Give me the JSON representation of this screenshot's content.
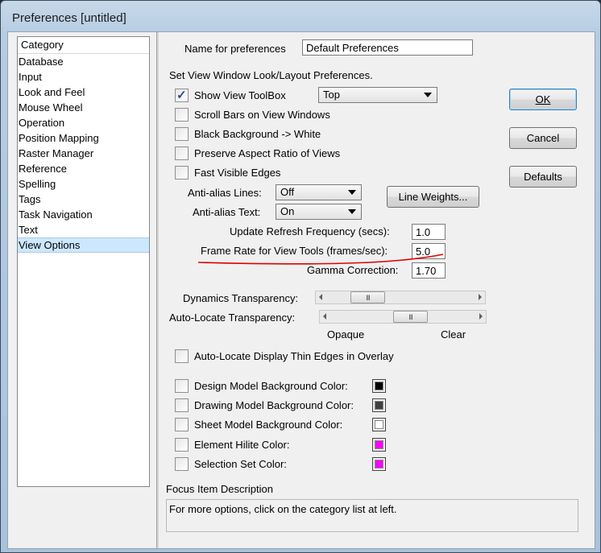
{
  "window": {
    "title": "Preferences [untitled]"
  },
  "category": {
    "header": "Category",
    "items": [
      "Database",
      "Input",
      "Look and Feel",
      "Mouse Wheel",
      "Operation",
      "Position Mapping",
      "Raster Manager",
      "Reference",
      "Spelling",
      "Tags",
      "Task Navigation",
      "Text",
      "View Options"
    ],
    "selected": "View Options"
  },
  "name_field": {
    "label": "Name for preferences",
    "value": "Default Preferences"
  },
  "section_title": "Set View Window Look/Layout Preferences.",
  "checkboxes": [
    {
      "label": "Show View ToolBox",
      "checked": true
    },
    {
      "label": "Scroll Bars on View Windows",
      "checked": false
    },
    {
      "label": "Black Background -> White",
      "checked": false
    },
    {
      "label": "Preserve Aspect Ratio of Views",
      "checked": false
    },
    {
      "label": "Fast Visible Edges",
      "checked": false
    }
  ],
  "toolbox_position": {
    "value": "Top"
  },
  "antialias_lines": {
    "label": "Anti-alias Lines:",
    "value": "Off"
  },
  "antialias_text": {
    "label": "Anti-alias Text:",
    "value": "On"
  },
  "line_weights_button": "Line Weights...",
  "update_refresh": {
    "label": "Update Refresh Frequency (secs):",
    "value": "1.0"
  },
  "frame_rate": {
    "label": "Frame Rate for View Tools (frames/sec):",
    "value": "5.0"
  },
  "gamma": {
    "label": "Gamma Correction:",
    "value": "1.70"
  },
  "dynamics_transparency": {
    "label": "Dynamics Transparency:",
    "level": 0.22
  },
  "autolocate_transparency": {
    "label": "Auto-Locate Transparency:",
    "level": 0.55
  },
  "slider_scale": {
    "left": "Opaque",
    "right": "Clear"
  },
  "thin_edges": {
    "label": "Auto-Locate Display Thin Edges in Overlay",
    "checked": false
  },
  "colors": [
    {
      "label": "Design Model Background Color:",
      "color": "#000000",
      "checked": false
    },
    {
      "label": "Drawing Model Background Color:",
      "color": "#404040",
      "checked": false
    },
    {
      "label": "Sheet Model Background Color:",
      "color": "#ffffff",
      "checked": false
    },
    {
      "label": "Element Hilite Color:",
      "color": "#ff00ff",
      "checked": false
    },
    {
      "label": "Selection Set Color:",
      "color": "#ff00ff",
      "checked": false
    }
  ],
  "buttons": {
    "ok": "OK",
    "cancel": "Cancel",
    "defaults": "Defaults"
  },
  "focus": {
    "title": "Focus Item Description",
    "text": "For more options, click on the category list at left."
  },
  "annotation_color": "#e00000"
}
